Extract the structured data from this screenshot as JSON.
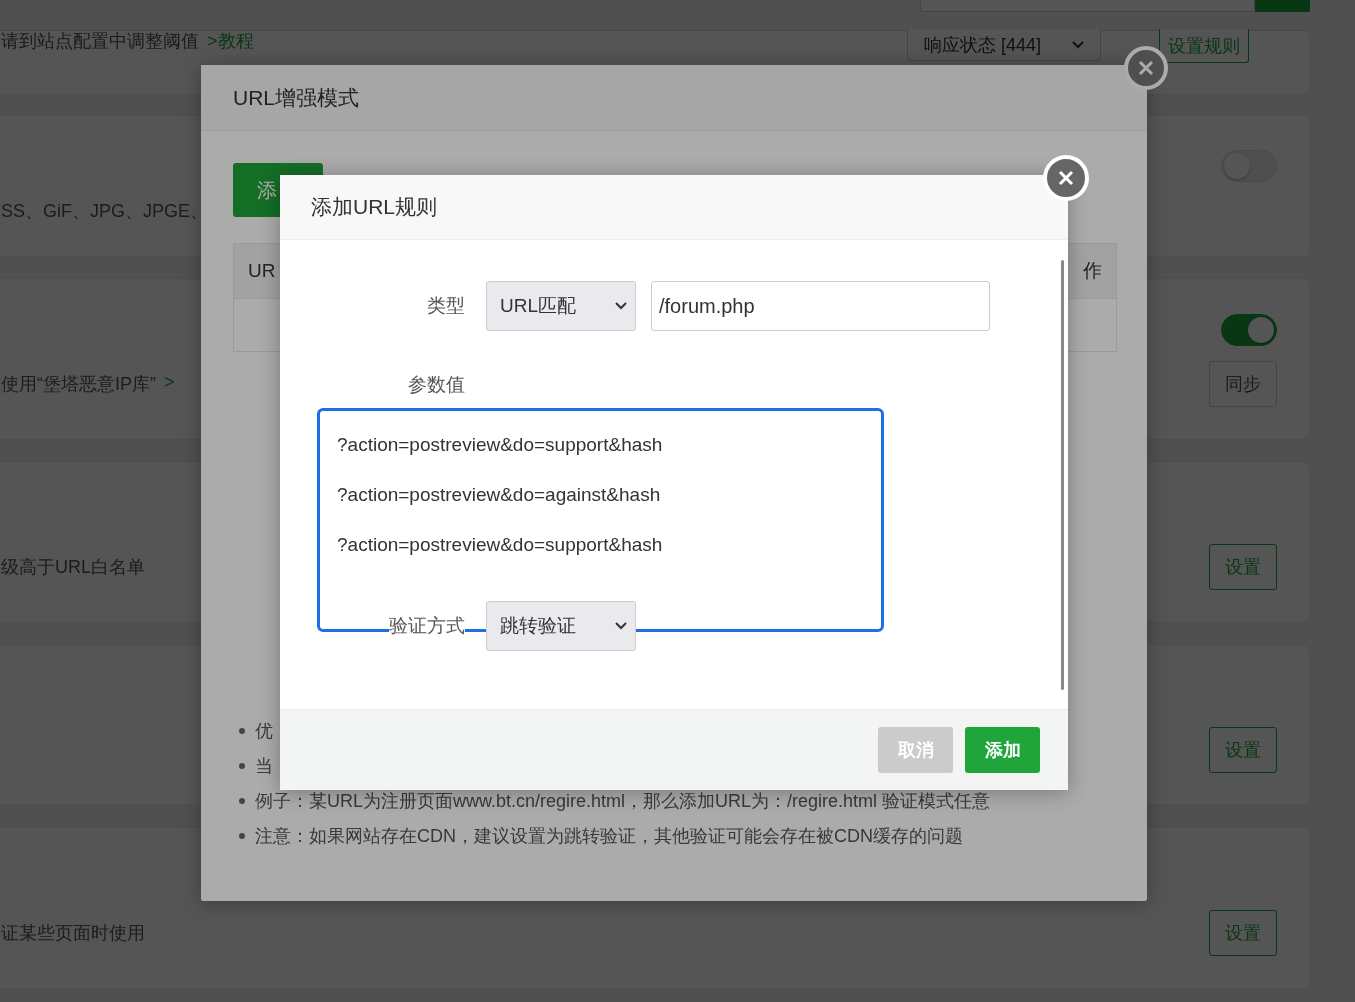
{
  "background": {
    "cards": [
      {
        "kind": "rule",
        "text": "请到站点配置中调整阈值",
        "link": ">教程",
        "dropdown": "响应状态 [444]",
        "button": "设置规则"
      },
      {
        "kind": "toggle",
        "text": "SS、GiF、JPG、JPGE、",
        "on": false
      },
      {
        "kind": "toggle_sync",
        "text": "使用“堡塔恶意IP库”",
        "link": ">",
        "on": true,
        "button": "同步"
      },
      {
        "kind": "button",
        "text": "级高于URL白名单",
        "button": "设置"
      },
      {
        "kind": "button",
        "button": "设置"
      },
      {
        "kind": "button",
        "text": "证某些页面时使用",
        "button": "设置"
      }
    ]
  },
  "outer_dialog": {
    "title": "URL增强模式",
    "add_button": "添",
    "table": {
      "columns": [
        "UR",
        "作"
      ]
    },
    "notes": [
      "优",
      "当",
      "例子：某URL为注册页面www.bt.cn/regire.html，那么添加URL为：/regire.html 验证模式任意",
      "注意：如果网站存在CDN，建议设置为跳转验证，其他验证可能会存在被CDN缓存的问题"
    ]
  },
  "inner_dialog": {
    "title": "添加URL规则",
    "type_label": "类型",
    "type_select": "URL匹配",
    "url_value": "/forum.php",
    "params_label": "参数值",
    "params_lines": [
      "?action=postreview&do=support&hash",
      "?action=postreview&do=against&hash",
      "?action=postreview&do=support&hash"
    ],
    "auth_label": "验证方式",
    "auth_select": "跳转验证",
    "buttons": [
      {
        "kind": "cancel",
        "label": "取消"
      },
      {
        "kind": "primary",
        "label": "添加"
      }
    ]
  }
}
